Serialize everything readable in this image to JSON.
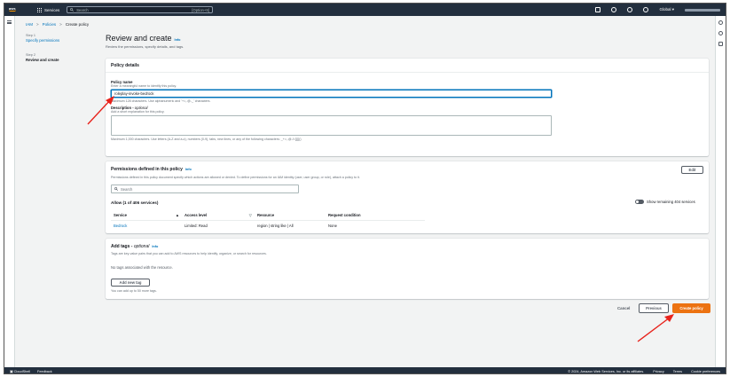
{
  "nav": {
    "logo_text": "aws",
    "services_label": "Services",
    "search_placeholder": "Search",
    "search_shortcut": "[Option+S]",
    "region": "Global ▾"
  },
  "breadcrumb": [
    "IAM",
    ">",
    "Policies",
    ">",
    "Create policy"
  ],
  "steps": [
    {
      "num": "Step 1",
      "label": "Specify permissions"
    },
    {
      "num": "Step 2",
      "label": "Review and create"
    }
  ],
  "page": {
    "title": "Review and create",
    "info": "Info",
    "description": "Review the permissions, specify details, and tags."
  },
  "policy_details": {
    "heading": "Policy details",
    "name_label": "Policy name",
    "name_hint": "Enter a meaningful name to identify this policy.",
    "name_value": "roleplay-invoke-bedrock",
    "name_constraint": "Maximum 128 characters. Use alphanumeric and '+=,.@-_' characters.",
    "desc_label": "Description",
    "desc_optional": "optional",
    "desc_hint": "Add a short explanation for this policy.",
    "desc_constraint": "Maximum 1,000 characters. Use letters (A-Z and a-z), numbers (0-9), tabs, new lines, or any of the following characters: _+=,.@-/\\:[]{}()"
  },
  "permissions": {
    "heading": "Permissions defined in this policy",
    "info": "Info",
    "description": "Permissions defined in this policy document specify which actions are allowed or denied. To define permissions for an IAM identity (user, user group, or role), attach a policy to it.",
    "edit_label": "Edit",
    "search_placeholder": "Search",
    "allow_label": "Allow (1 of 406 services)",
    "toggle_label": "Show remaining 404 services",
    "columns": [
      "Service",
      "Access level",
      "Resource",
      "Request condition"
    ],
    "rows": [
      {
        "service": "Bedrock",
        "access": "Limited: Read",
        "resource": "region | string like | All",
        "condition": "None"
      }
    ]
  },
  "tags": {
    "heading": "Add tags",
    "optional": "optional",
    "info": "Info",
    "description": "Tags are key-value pairs that you can add to AWS resources to help identify, organize, or search for resources.",
    "empty": "No tags associated with the resource.",
    "add_label": "Add new tag",
    "limit": "You can add up to 50 more tags."
  },
  "actions": {
    "cancel": "Cancel",
    "previous": "Previous",
    "create": "Create policy"
  },
  "footer": {
    "cloudshell": "CloudShell",
    "feedback": "Feedback",
    "copyright": "© 2024, Amazon Web Services, Inc. or its affiliates.",
    "privacy": "Privacy",
    "terms": "Terms",
    "cookies": "Cookie preferences"
  },
  "colors": {
    "nav_bg": "#232f3e",
    "link": "#0073bb",
    "primary": "#ec7211",
    "annotation_arrow": "#e8221b"
  }
}
